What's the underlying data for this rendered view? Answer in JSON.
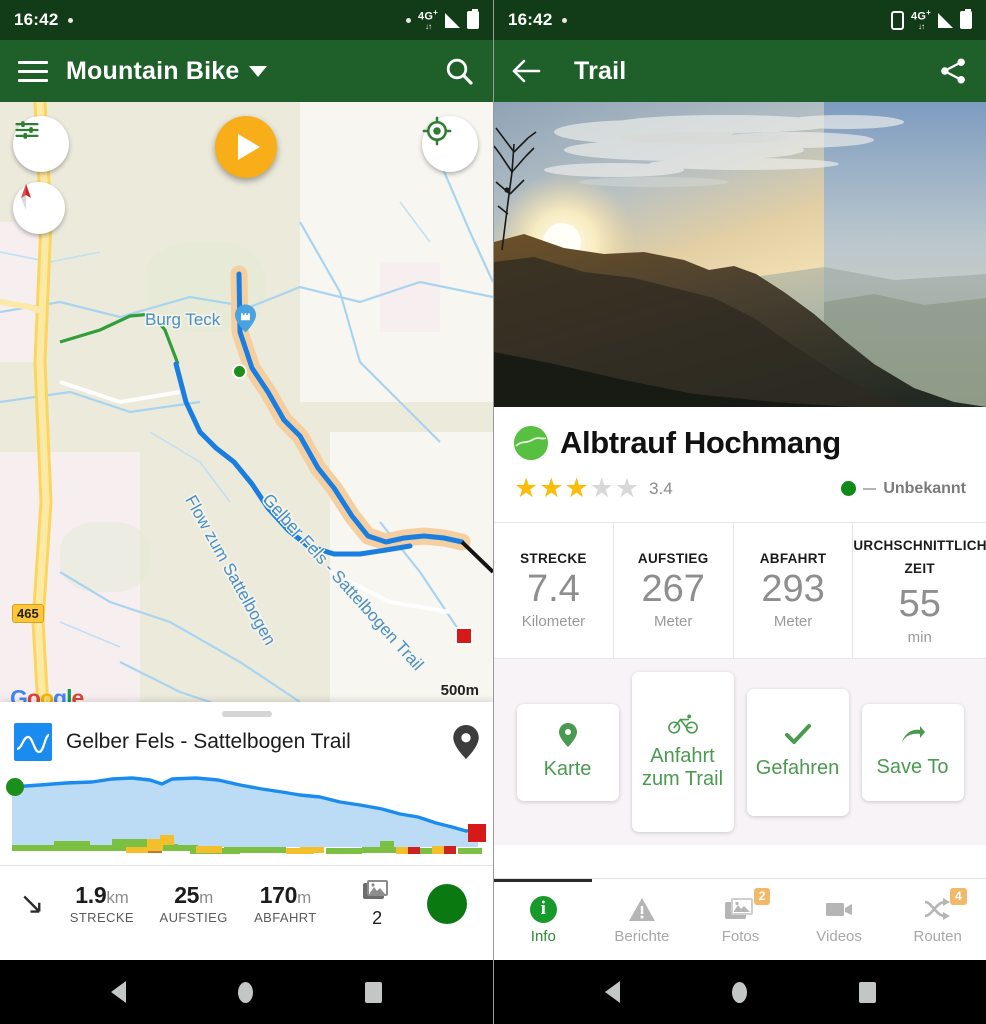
{
  "left": {
    "status": {
      "time": "16:42",
      "network": "4G",
      "network_sup": "+"
    },
    "appbar": {
      "title": "Mountain Bike",
      "menu_icon": "hamburger-icon",
      "search_icon": "search-icon",
      "caret_icon": "chevron-down-icon"
    },
    "map": {
      "poi_label": "Burg Teck",
      "trail_label_1": "Flow zum Sattelbogen",
      "trail_label_2": "Gelber Fels - Sattelbogen Trail",
      "road_shield": "465",
      "attribution": "Google",
      "scale_label": "500m",
      "controls": {
        "filter": "map-filter-icon",
        "compass": "compass-icon",
        "play": "play-button",
        "locate": "my-location-icon"
      }
    },
    "sheet": {
      "title": "Gelber Fels - Sattelbogen Trail",
      "elevation_icon": "elevation-profile-icon",
      "pin_icon": "map-pin-icon",
      "expand_icon": "expand-arrow-icon",
      "stats": [
        {
          "value": "1.9",
          "unit": "km",
          "label": "STRECKE"
        },
        {
          "value": "25",
          "unit": "m",
          "label": "AUFSTIEG"
        },
        {
          "value": "170",
          "unit": "m",
          "label": "ABFAHRT"
        }
      ],
      "photo_count": "2",
      "photo_icon": "photos-icon"
    }
  },
  "right": {
    "status": {
      "time": "16:42",
      "network": "4G",
      "network_sup": "+"
    },
    "appbar": {
      "back_icon": "back-arrow-icon",
      "title": "Trail",
      "share_icon": "share-icon"
    },
    "hero": {
      "alt": "sunset-ridge-photo"
    },
    "trail": {
      "name": "Albtrauf Hochmang",
      "rating_value": "3.4",
      "stars_filled": 3,
      "stars_total": 5,
      "difficulty_label": "Unbekannt",
      "difficulty_color": "#0f8a16"
    },
    "stats": [
      {
        "label": "STRECKE",
        "value": "7.4",
        "unit": "Kilometer"
      },
      {
        "label": "AUFSTIEG",
        "value": "267",
        "unit": "Meter"
      },
      {
        "label": "ABFAHRT",
        "value": "293",
        "unit": "Meter"
      },
      {
        "label": "DURCHSCHNITTLICHE ZEIT",
        "value": "55",
        "unit": "min"
      }
    ],
    "actions": [
      {
        "label": "Karte",
        "icon": "map-pin-icon",
        "glyph": "•"
      },
      {
        "label": "Anfahrt zum Trail",
        "icon": "bicycle-icon",
        "glyph": "•"
      },
      {
        "label": "Gefahren",
        "icon": "check-icon",
        "glyph": "✔"
      },
      {
        "label": "Save To",
        "icon": "share-arrow-icon",
        "glyph": "•"
      }
    ],
    "tabs": [
      {
        "label": "Info",
        "icon": "info-icon",
        "active": true,
        "badge": ""
      },
      {
        "label": "Berichte",
        "icon": "warning-icon",
        "active": false,
        "badge": ""
      },
      {
        "label": "Fotos",
        "icon": "photos-icon",
        "active": false,
        "badge": "2"
      },
      {
        "label": "Videos",
        "icon": "video-icon",
        "active": false,
        "badge": ""
      },
      {
        "label": "Routen",
        "icon": "routes-icon",
        "active": false,
        "badge": "4"
      }
    ]
  },
  "navbar": {
    "back": "nav-back-icon",
    "home": "nav-home-icon",
    "recents": "nav-recents-icon"
  },
  "theme": {
    "appbar_green": "#1e5f2a",
    "status_green": "#113c17",
    "accent_orange": "#f7ae18",
    "link_green": "#4a9a4f"
  }
}
